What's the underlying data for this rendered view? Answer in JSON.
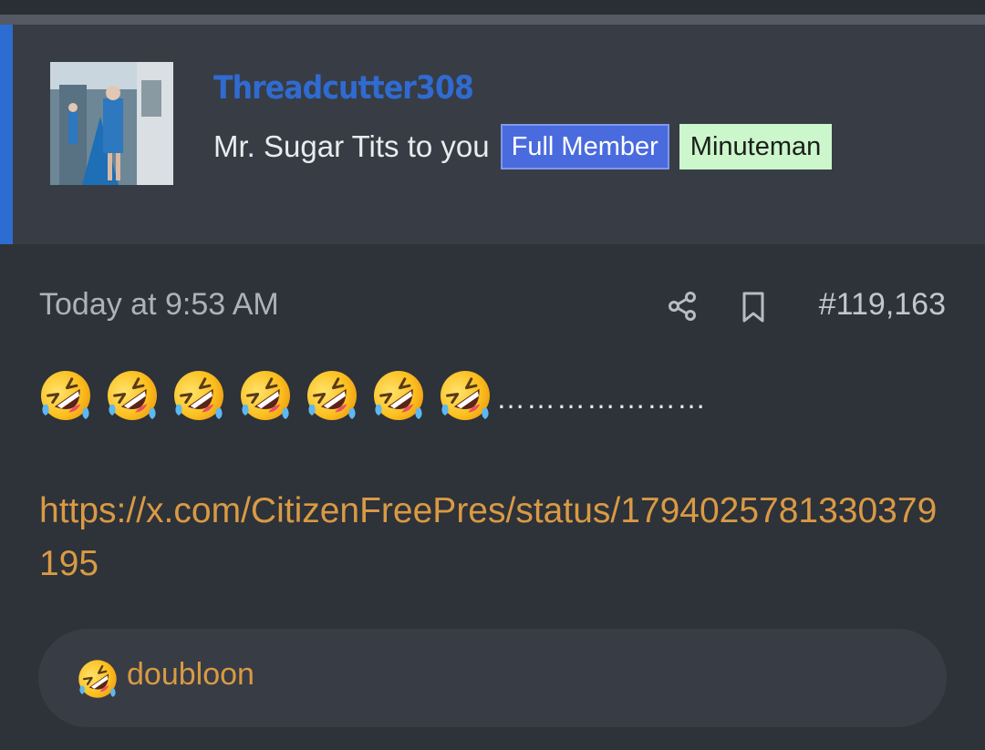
{
  "author": {
    "username": "Threadcutter308",
    "user_title": "Mr. Sugar Tits to you",
    "badges": [
      "Full Member",
      "Minuteman"
    ]
  },
  "post": {
    "timestamp": "Today at 9:53 AM",
    "number": "#119,163",
    "emoji_repeat": 7,
    "emoji_name": "rolling-on-the-floor-laughing",
    "trailing_text": "…………………",
    "link": "https://x.com/CitizenFreePres/status/1794025781330379195"
  },
  "reactions": {
    "emoji_name": "rolling-on-the-floor-laughing",
    "users": "doubloon"
  },
  "colors": {
    "accent": "#2d6cd0",
    "link": "#d99a44",
    "badge_blue": "#4a6bde",
    "badge_green": "#ccf6cc"
  }
}
